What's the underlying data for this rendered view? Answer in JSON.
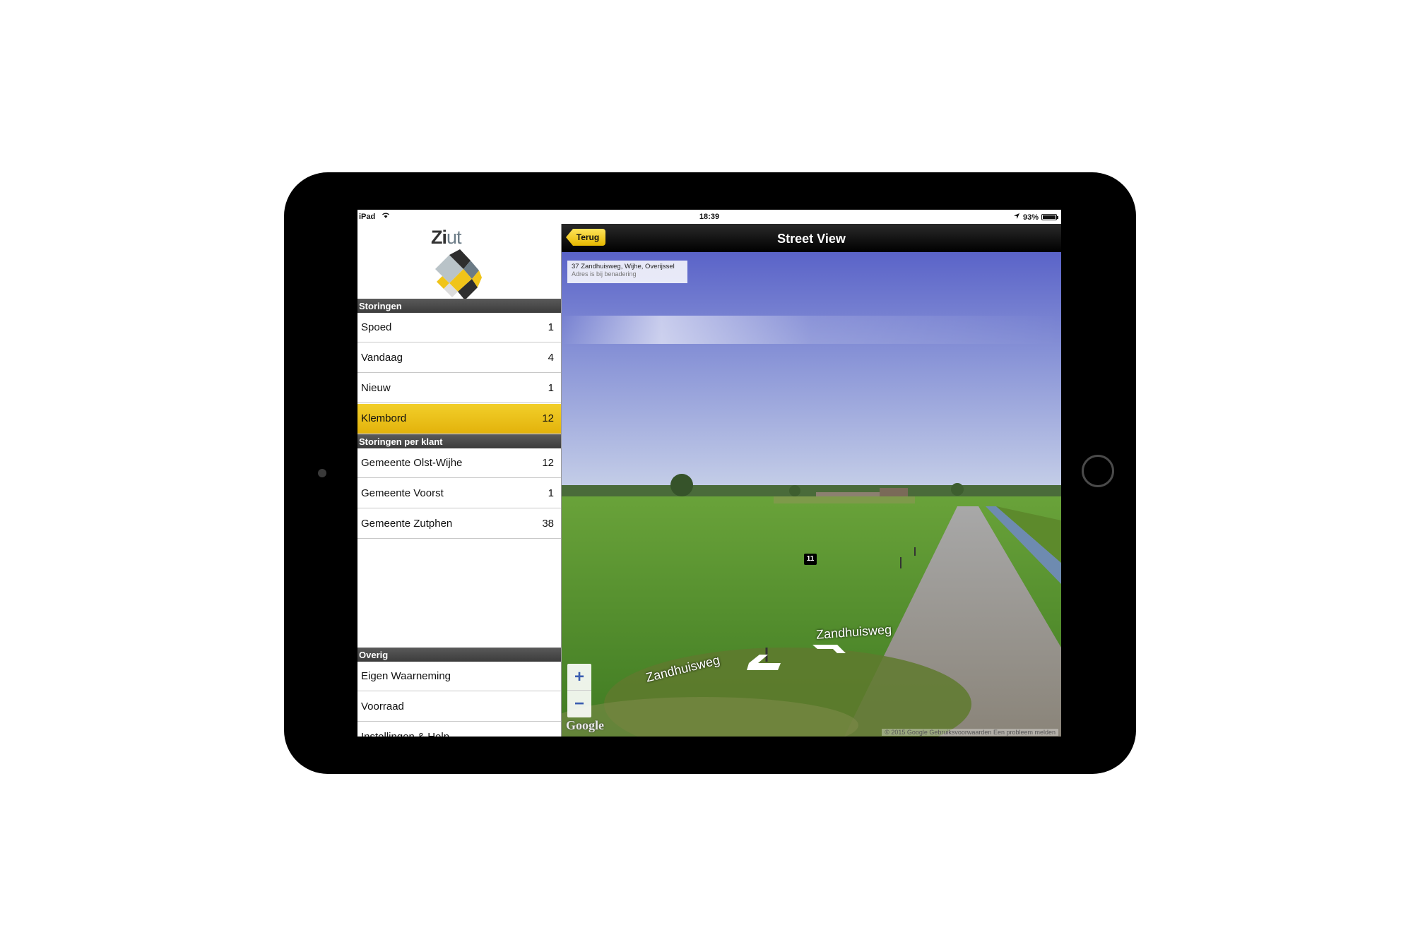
{
  "status_bar": {
    "carrier": "iPad",
    "time": "18:39",
    "battery": "93%"
  },
  "sidebar": {
    "logo_text_a": "Zi",
    "logo_text_b": "ut",
    "sections": [
      {
        "title": "Storingen",
        "items": [
          {
            "label": "Spoed",
            "count": "1"
          },
          {
            "label": "Vandaag",
            "count": "4"
          },
          {
            "label": "Nieuw",
            "count": "1"
          },
          {
            "label": "Klembord",
            "count": "12",
            "active": true
          }
        ]
      },
      {
        "title": "Storingen per klant",
        "items": [
          {
            "label": "Gemeente Olst-Wijhe",
            "count": "12"
          },
          {
            "label": "Gemeente Voorst",
            "count": "1"
          },
          {
            "label": "Gemeente Zutphen",
            "count": "38"
          }
        ]
      },
      {
        "title": "Overig",
        "items": [
          {
            "label": "Eigen Waarneming"
          },
          {
            "label": "Voorraad"
          },
          {
            "label": "Instellingen & Help"
          }
        ]
      }
    ]
  },
  "street_view": {
    "back_label": "Terug",
    "title": "Street View",
    "address": "37 Zandhuisweg, Wijhe, Overijssel",
    "address_note": "Adres is bij benadering",
    "road_name": "Zandhuisweg",
    "marker": "11",
    "zoom_in": "+",
    "zoom_out": "−",
    "google_logo": "Google",
    "copyright": "© 2015 Google   Gebruiksvoorwaarden   Een probleem melden",
    "colors": {
      "accent": "#e8b90f",
      "sky_top": "#5a63c8",
      "grass": "#4e8a2a"
    }
  }
}
